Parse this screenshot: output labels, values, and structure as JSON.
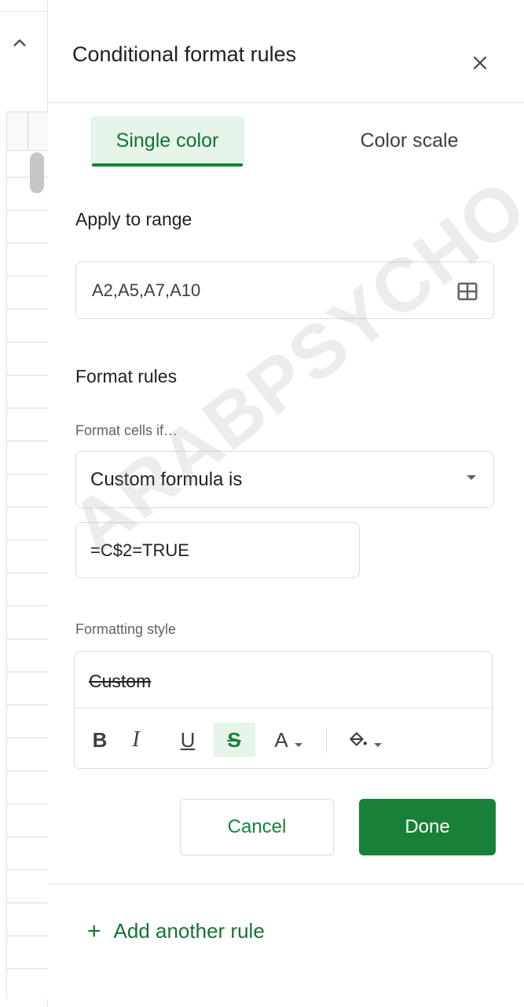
{
  "panel": {
    "title": "Conditional format rules",
    "close_icon": "close-icon"
  },
  "tabs": [
    {
      "label": "Single color",
      "active": true
    },
    {
      "label": "Color scale",
      "active": false
    }
  ],
  "apply_range": {
    "label": "Apply to range",
    "value": "A2,A5,A7,A10",
    "icon": "grid-select-icon"
  },
  "format_rules": {
    "label": "Format rules",
    "condition_label": "Format cells if…",
    "condition_value": "Custom formula is",
    "formula_value": "=C$2=TRUE"
  },
  "formatting_style": {
    "label": "Formatting style",
    "preview_text": "Custom",
    "toolbar": {
      "bold": "B",
      "italic": "I",
      "underline": "U",
      "strikethrough": "S",
      "text_color": "A",
      "strikethrough_active": true
    }
  },
  "actions": {
    "cancel_label": "Cancel",
    "done_label": "Done"
  },
  "add_rule": {
    "plus": "+",
    "label": "Add another rule"
  },
  "watermark": "ARABPSYCHO",
  "colors": {
    "accent_green": "#188038",
    "active_tab_bg": "#e6f4ea",
    "text_primary": "#202124"
  }
}
